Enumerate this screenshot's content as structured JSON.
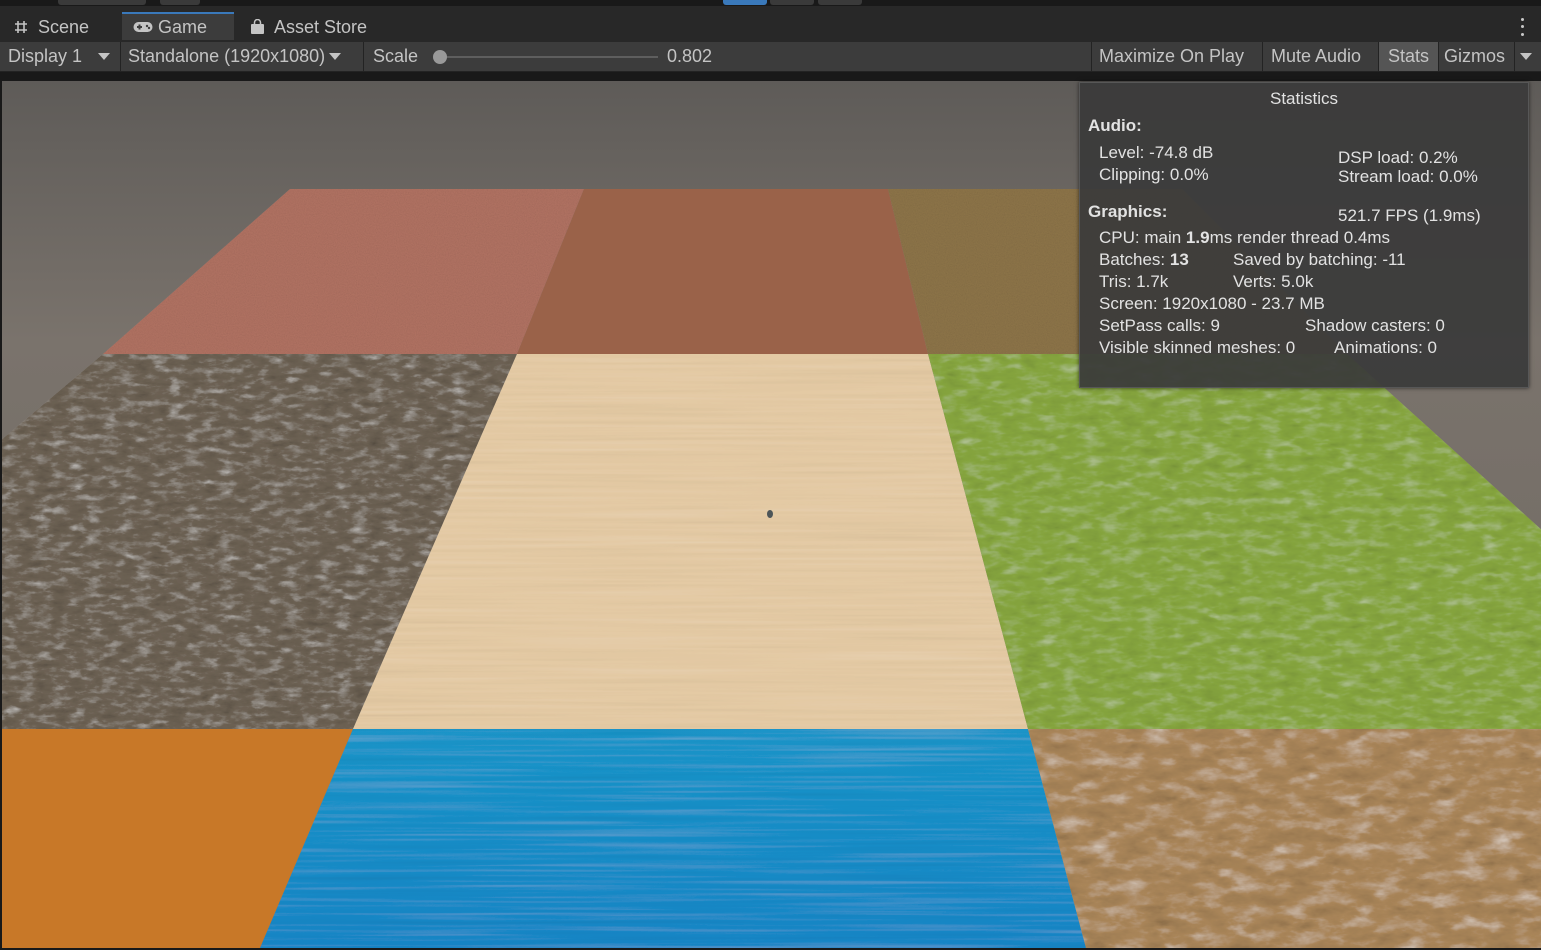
{
  "tabs": [
    {
      "label": "Scene",
      "icon": "grid-hash-icon"
    },
    {
      "label": "Game",
      "icon": "gamepad-icon"
    },
    {
      "label": "Asset Store",
      "icon": "shopping-bag-icon"
    }
  ],
  "toolbar": {
    "display": "Display 1",
    "resolution": "Standalone (1920x1080)",
    "scale_label": "Scale",
    "scale_value": "0.802",
    "maximize": "Maximize On Play",
    "mute": "Mute Audio",
    "stats": "Stats",
    "gizmos": "Gizmos"
  },
  "stats": {
    "title": "Statistics",
    "audio_header": "Audio:",
    "level": "Level: -74.8 dB",
    "clipping": "Clipping: 0.0%",
    "dsp": "DSP load: 0.2%",
    "stream": "Stream load: 0.0%",
    "graphics_header": "Graphics:",
    "fps": "521.7 FPS (1.9ms)",
    "cpu_prefix": "CPU: main ",
    "cpu_main": "1.9",
    "cpu_suffix": "ms  render thread 0.4ms",
    "batches_prefix": "Batches: ",
    "batches": "13",
    "saved_batching": "Saved by batching: -11",
    "tris": "Tris: 1.7k",
    "verts": "Verts: 5.0k",
    "screen": "Screen: 1920x1080 - 23.7 MB",
    "setpass": "SetPass calls: 9",
    "shadow": "Shadow casters: 0",
    "skinned": "Visible skinned meshes: 0",
    "animations": "Animations: 0"
  },
  "colors": {
    "accent": "#3a79bb",
    "panel": "#3c3c3c",
    "tile_red_dirt": "#b07060",
    "tile_brown": "#9a6048",
    "tile_olive": "#8d7548",
    "tile_rocky_mud": "#6b5f52",
    "tile_sand": "#e3c9a2",
    "tile_grass": "#86a43e",
    "tile_orange": "#c87828",
    "tile_water": "#1a94c8",
    "tile_dirt": "#a98458"
  }
}
